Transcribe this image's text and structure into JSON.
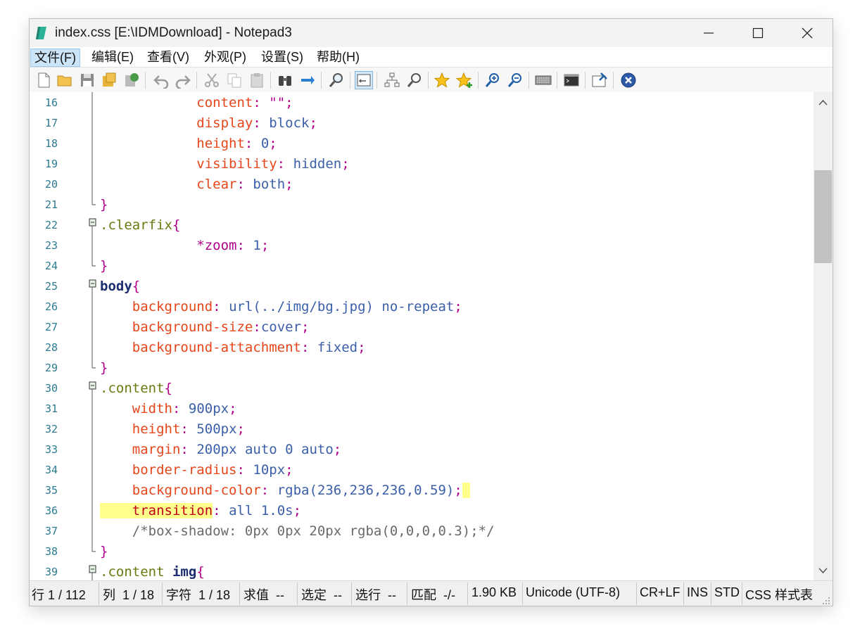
{
  "window": {
    "title": "index.css [E:\\IDMDownload] - Notepad3"
  },
  "menu": [
    "文件(F)",
    "编辑(E)",
    "查看(V)",
    "外观(P)",
    "设置(S)",
    "帮助(H)"
  ],
  "toolbar": {
    "icons": [
      "new-file-icon",
      "open-folder-icon",
      "save-icon",
      "save-as-icon",
      "save-copy-icon",
      "undo-icon",
      "redo-icon",
      "cut-icon",
      "copy-icon",
      "paste-icon",
      "find-icon",
      "replace-icon",
      "find-next-icon",
      "word-wrap-icon",
      "goto-line-icon",
      "find-in-files-icon",
      "bookmark-icon",
      "bookmark-add-icon",
      "zoom-in-icon",
      "zoom-out-icon",
      "keyboard-icon",
      "terminal-icon",
      "pin-icon",
      "close-circle-icon"
    ]
  },
  "editor": {
    "lines": [
      {
        "n": "16",
        "text": "            content: \"\";"
      },
      {
        "n": "17",
        "text": "            display: block;"
      },
      {
        "n": "18",
        "text": "            height: 0;"
      },
      {
        "n": "19",
        "text": "            visibility: hidden;"
      },
      {
        "n": "20",
        "text": "            clear: both;"
      },
      {
        "n": "21",
        "text": "}"
      },
      {
        "n": "22",
        "text": ".clearfix{"
      },
      {
        "n": "23",
        "text": "            *zoom: 1;"
      },
      {
        "n": "24",
        "text": "}"
      },
      {
        "n": "25",
        "text": "body{"
      },
      {
        "n": "26",
        "text": "    background: url(../img/bg.jpg) no-repeat;"
      },
      {
        "n": "27",
        "text": "    background-size:cover;"
      },
      {
        "n": "28",
        "text": "    background-attachment: fixed;"
      },
      {
        "n": "29",
        "text": "}"
      },
      {
        "n": "30",
        "text": ".content{"
      },
      {
        "n": "31",
        "text": "    width: 900px;"
      },
      {
        "n": "32",
        "text": "    height: 500px;"
      },
      {
        "n": "33",
        "text": "    margin: 200px auto 0 auto;"
      },
      {
        "n": "34",
        "text": "    border-radius: 10px;"
      },
      {
        "n": "35",
        "text": "    background-color: rgba(236,236,236,0.59);"
      },
      {
        "n": "36",
        "text": "    transition: all 1.0s;"
      },
      {
        "n": "37",
        "text": "    /*box-shadow: 0px 0px 20px rgba(0,0,0,0.3);*/"
      },
      {
        "n": "38",
        "text": "}"
      },
      {
        "n": "39",
        "text": ".content img{"
      }
    ]
  },
  "statusbar": [
    "行 1 / 112",
    "列  1 / 18",
    "字符  1 / 18",
    "求值  --",
    "选定  --",
    "选行  --",
    "匹配  -/-",
    "1.90 KB",
    "Unicode (UTF-8)",
    "CR+LF",
    "INS",
    "STD",
    "CSS 样式表"
  ],
  "colors": {
    "accent": "#cce4f7",
    "highlight": "#ffff8c"
  }
}
